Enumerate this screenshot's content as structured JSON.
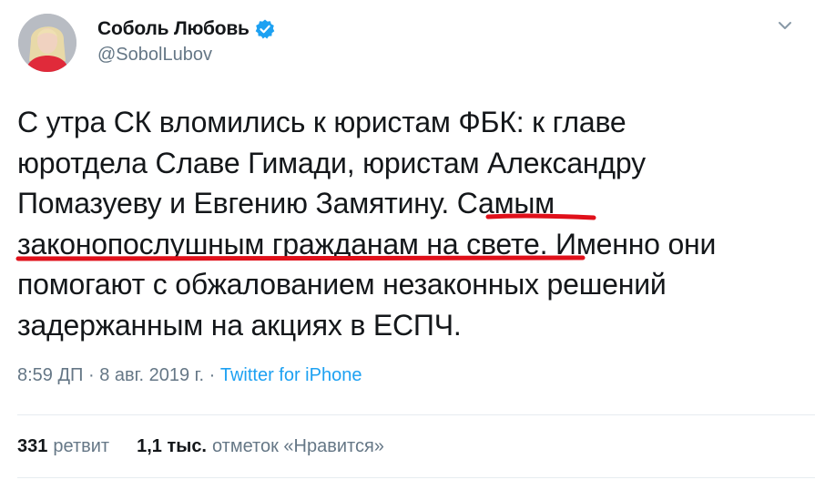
{
  "author": {
    "display_name": "Соболь Любовь",
    "handle": "@SobolLubov",
    "verified": true
  },
  "tweet": {
    "lines": [
      "С утра СК вломились к юристам ФБК: к главе",
      "юротдела Славе Гимади, юристам Александру",
      "Помазуеву и Евгению Замятину. Самым",
      "законопослушным гражданам на свете. Именно они",
      "помогают с обжалованием незаконных решений",
      "задержанным на акциях в ЕСПЧ."
    ]
  },
  "meta": {
    "time": "8:59 ДП",
    "separator": " · ",
    "date": "8 авг. 2019 г.",
    "source": "Twitter for iPhone"
  },
  "stats": {
    "retweets_count": "331",
    "retweets_label": "ретвит",
    "likes_count": "1,1 тыс.",
    "likes_label": "отметок «Нравится»"
  },
  "colors": {
    "text": "#14171a",
    "secondary": "#657786",
    "link": "#1da1f2",
    "highlight_underline": "#e0101a"
  },
  "icons": {
    "verified": "verified-badge-icon",
    "more": "chevron-down-icon"
  }
}
